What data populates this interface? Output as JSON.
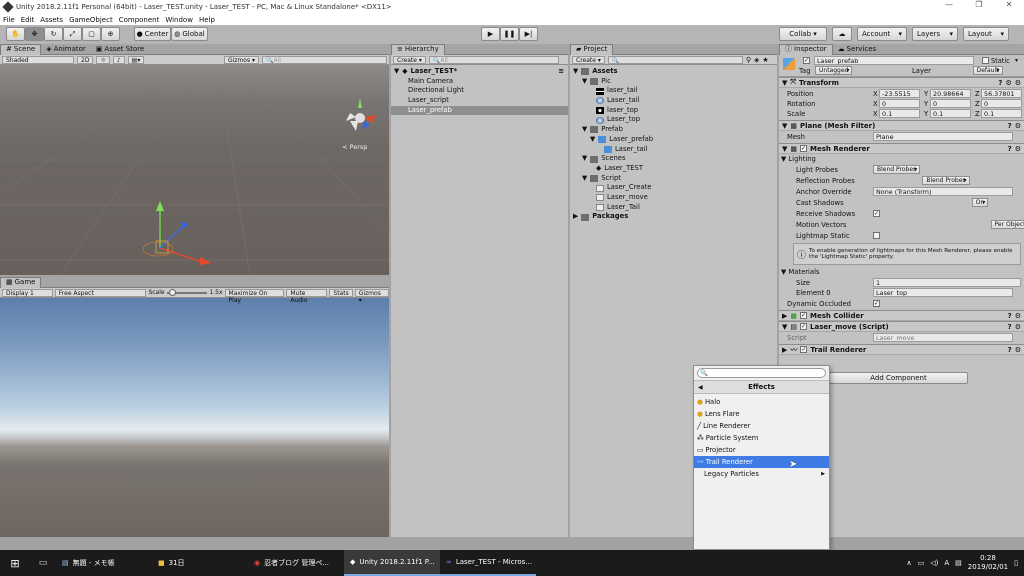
{
  "window": {
    "title": "Unity 2018.2.11f1 Personal (64bit) - Laser_TEST.unity - Laser_TEST - PC, Mac & Linux Standalone* <DX11>"
  },
  "menubar": [
    "File",
    "Edit",
    "Assets",
    "GameObject",
    "Component",
    "Window",
    "Help"
  ],
  "toolbar": {
    "center": "Center",
    "global": "Global",
    "collab": "Collab ▾",
    "account": "Account",
    "layers": "Layers",
    "layout": "Layout"
  },
  "scene": {
    "tabs": [
      "Scene",
      "Animator",
      "Asset Store"
    ],
    "shading": "Shaded",
    "mode2d": "2D",
    "gizmos": "Gizmos ▾",
    "search_placeholder": "All",
    "persp": "< Persp"
  },
  "game": {
    "tab": "Game",
    "display": "Display 1",
    "aspect": "Free Aspect",
    "scale_label": "Scale",
    "scale_value": "1.5x",
    "maximize": "Maximize On Play",
    "mute": "Mute Audio",
    "stats": "Stats",
    "gizmos": "Gizmos ▾"
  },
  "hierarchy": {
    "tab": "Hierarchy",
    "create": "Create ▾",
    "search_placeholder": "All",
    "scene": "Laser_TEST*",
    "items": [
      "Main Camera",
      "Directional Light",
      "Laser_script",
      "Laser_prefab"
    ]
  },
  "project": {
    "tab": "Project",
    "create": "Create ▾",
    "assets": "Assets",
    "pic": "Pic",
    "pic_items": [
      "laser_tail",
      "Laser_tail",
      "laser_top",
      "Laser_top"
    ],
    "prefab": "Prefab",
    "laser_prefab": "Laser_prefab",
    "laser_tail_prefab": "Laser_tail",
    "scenes": "Scenes",
    "laser_test": "Laser_TEST",
    "script": "Script",
    "scripts": [
      "Laser_Create",
      "Laser_move",
      "Laser_Tail"
    ],
    "packages": "Packages"
  },
  "inspector": {
    "tabs": [
      "Inspector",
      "Services"
    ],
    "object_name": "Laser_prefab",
    "static": "Static",
    "tag_label": "Tag",
    "tag": "Untagged",
    "layer_label": "Layer",
    "layer": "Default",
    "transform": {
      "title": "Transform",
      "position": "Position",
      "rotation": "Rotation",
      "scale": "Scale",
      "pos": [
        "-23.5515",
        "20.98664",
        "56.37801"
      ],
      "rot": [
        "0",
        "0",
        "0"
      ],
      "scl": [
        "0.1",
        "0.1",
        "0.1"
      ]
    },
    "mesh_filter": {
      "title": "Plane (Mesh Filter)",
      "mesh_label": "Mesh",
      "mesh": "Plane"
    },
    "mesh_renderer": {
      "title": "Mesh Renderer",
      "lighting": "Lighting",
      "rows": [
        {
          "label": "Light Probes",
          "value": "Blend Probes"
        },
        {
          "label": "Reflection Probes",
          "value": "Blend Probes"
        },
        {
          "label": "Anchor Override",
          "value": "None (Transform)"
        },
        {
          "label": "Cast Shadows",
          "value": "On"
        },
        {
          "label": "Receive Shadows",
          "value": ""
        },
        {
          "label": "Motion Vectors",
          "value": "Per Object Motion"
        },
        {
          "label": "Lightmap Static",
          "value": ""
        }
      ],
      "info": "To enable generation of lightmaps for this Mesh Renderer, please enable the 'Lightmap Static' property.",
      "materials": "Materials",
      "size_label": "Size",
      "size": "1",
      "element_label": "Element 0",
      "element": "Laser_top",
      "dynamic": "Dynamic Occluded"
    },
    "mesh_collider": "Mesh Collider",
    "laser_move": {
      "title": "Laser_move (Script)",
      "script_label": "Script",
      "script": "Laser_move"
    },
    "trail_renderer": "Trail Renderer",
    "add_component": "Add Component"
  },
  "popup": {
    "header": "Effects",
    "items": [
      "Halo",
      "Lens Flare",
      "Line Renderer",
      "Particle System",
      "Projector",
      "Trail Renderer",
      "Legacy Particles"
    ]
  },
  "taskbar": {
    "items": [
      "無題 - メモ帳",
      "31日",
      "忍者ブログ 管理ペ...",
      "Unity 2018.2.11f1 P...",
      "Laser_TEST - Micros..."
    ],
    "time": "0:28",
    "date": "2019/02/01"
  },
  "colors": {
    "accent": "#3e7ce4",
    "taskbar": "#1b1b1b",
    "scene_bg": "#6b6561"
  }
}
